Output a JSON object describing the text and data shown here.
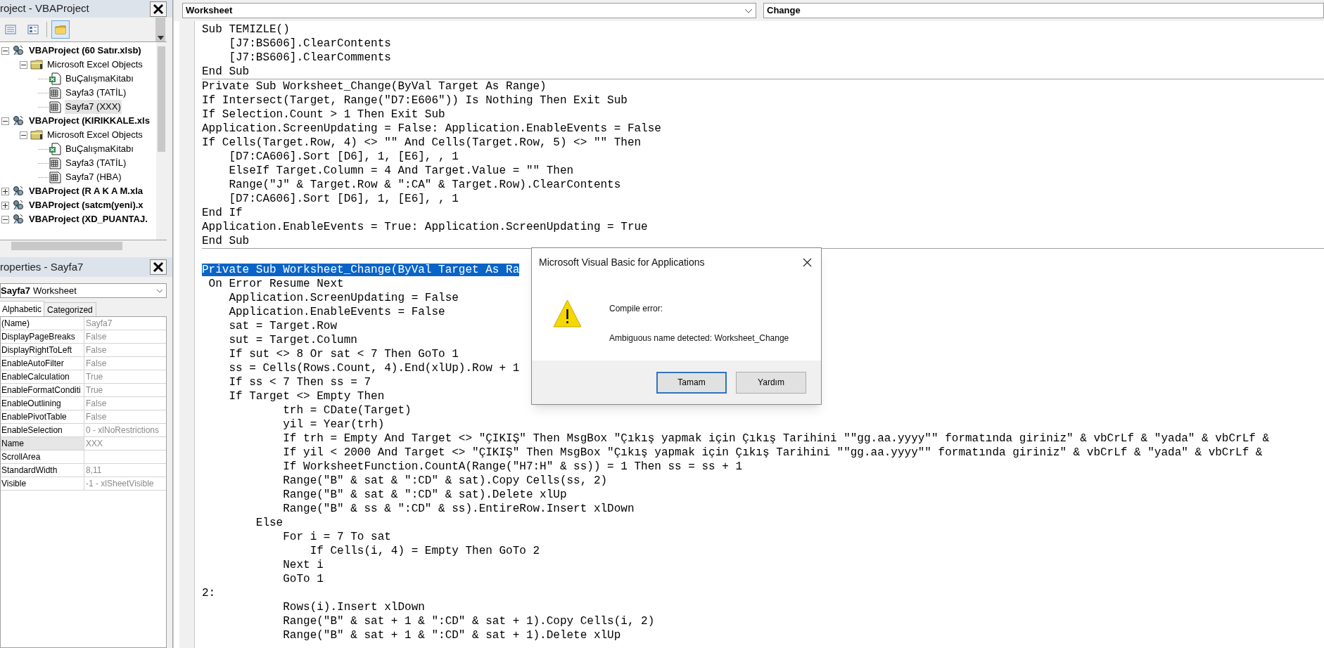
{
  "project_pane": {
    "title": "roject - VBAProject",
    "toolbar": [
      {
        "kind": "view-code",
        "pressed": false
      },
      {
        "kind": "view-object",
        "pressed": false
      },
      {
        "kind": "toggle-folders",
        "pressed": true
      }
    ],
    "tree": [
      {
        "kind": "project",
        "label": "VBAProject (60 Satır.xlsb)",
        "expanded": true,
        "selected": false,
        "children": [
          {
            "kind": "folder",
            "label": "Microsoft Excel Objects",
            "expanded": true,
            "selected": false,
            "children": [
              {
                "kind": "workbook",
                "label": "BuÇalışmaKitabı",
                "selected": false
              },
              {
                "kind": "sheet",
                "label": "Sayfa3 (TATİL)",
                "selected": false
              },
              {
                "kind": "sheet",
                "label": "Sayfa7 (XXX)",
                "selected": true
              }
            ]
          }
        ]
      },
      {
        "kind": "project",
        "label": "VBAProject (KIRIKKALE.xls",
        "expanded": true,
        "selected": false,
        "children": [
          {
            "kind": "folder",
            "label": "Microsoft Excel Objects",
            "expanded": true,
            "selected": false,
            "children": [
              {
                "kind": "workbook",
                "label": "BuÇalışmaKitabı",
                "selected": false
              },
              {
                "kind": "sheet",
                "label": "Sayfa3 (TATİL)",
                "selected": false
              },
              {
                "kind": "sheet",
                "label": "Sayfa7 (HBA)",
                "selected": false
              }
            ]
          }
        ]
      },
      {
        "kind": "project",
        "label": "VBAProject (R A K A M.xla",
        "expanded": false,
        "selected": false
      },
      {
        "kind": "project",
        "label": "VBAProject (satcm(yeni).x",
        "expanded": false,
        "selected": false
      },
      {
        "kind": "project",
        "label": "VBAProject (XD_PUANTAJ.",
        "expanded": true,
        "selected": false
      }
    ]
  },
  "properties_pane": {
    "title": "roperties - Sayfa7",
    "object_name": "Sayfa7",
    "object_type": "Worksheet",
    "tabs": [
      {
        "label": "Alphabetic",
        "selected": true
      },
      {
        "label": "Categorized",
        "selected": false
      }
    ],
    "rows": [
      {
        "name": "(Name)",
        "value": "Sayfa7",
        "selected": false
      },
      {
        "name": "DisplayPageBreaks",
        "value": "False",
        "selected": false
      },
      {
        "name": "DisplayRightToLeft",
        "value": "False",
        "selected": false
      },
      {
        "name": "EnableAutoFilter",
        "value": "False",
        "selected": false
      },
      {
        "name": "EnableCalculation",
        "value": "True",
        "selected": false
      },
      {
        "name": "EnableFormatConditi",
        "value": "True",
        "selected": false
      },
      {
        "name": "EnableOutlining",
        "value": "False",
        "selected": false
      },
      {
        "name": "EnablePivotTable",
        "value": "False",
        "selected": false
      },
      {
        "name": "EnableSelection",
        "value": "0 - xlNoRestrictions",
        "selected": false
      },
      {
        "name": "Name",
        "value": "XXX",
        "selected": true
      },
      {
        "name": "ScrollArea",
        "selected": false
      },
      {
        "name": "StandardWidth",
        "value": "8,11",
        "selected": false
      },
      {
        "name": "Visible",
        "value": "-1 - xlSheetVisible",
        "selected": false
      }
    ]
  },
  "code_window": {
    "object_dropdown": "Worksheet",
    "procedure_dropdown": "Change",
    "sections": [
      {
        "lines": [
          {
            "text": "Sub TEMIZLE()",
            "selected": false
          },
          {
            "text": "    [J7:BS606].ClearContents",
            "selected": false
          },
          {
            "text": "    [J7:BS606].ClearComments",
            "selected": false
          },
          {
            "text": "End Sub",
            "selected": false
          }
        ]
      },
      {
        "lines": [
          {
            "text": "Private Sub Worksheet_Change(ByVal Target As Range)",
            "selected": false
          },
          {
            "text": "If Intersect(Target, Range(\"D7:E606\")) Is Nothing Then Exit Sub",
            "selected": false
          },
          {
            "text": "If Selection.Count > 1 Then Exit Sub",
            "selected": false
          },
          {
            "text": "Application.ScreenUpdating = False: Application.EnableEvents = False",
            "selected": false
          },
          {
            "text": "If Cells(Target.Row, 4) <> \"\" And Cells(Target.Row, 5) <> \"\" Then",
            "selected": false
          },
          {
            "text": "    [D7:CA606].Sort [D6], 1, [E6], , 1",
            "selected": false
          },
          {
            "text": "    ElseIf Target.Column = 4 And Target.Value = \"\" Then",
            "selected": false
          },
          {
            "text": "    Range(\"J\" & Target.Row & \":CA\" & Target.Row).ClearContents",
            "selected": false
          },
          {
            "text": "    [D7:CA606].Sort [D6], 1, [E6], , 1",
            "selected": false
          },
          {
            "text": "End If",
            "selected": false
          },
          {
            "text": "Application.EnableEvents = True: Application.ScreenUpdating = True",
            "selected": false
          },
          {
            "text": "End Sub",
            "selected": false
          }
        ]
      },
      {
        "lines": [
          {
            "text": "Private Sub Worksheet_Change(ByVal Target As Ra",
            "selected": true
          },
          {
            "text": " On Error Resume Next",
            "selected": false
          },
          {
            "text": "    Application.ScreenUpdating = False",
            "selected": false
          },
          {
            "text": "    Application.EnableEvents = False",
            "selected": false
          },
          {
            "text": "    sat = Target.Row",
            "selected": false
          },
          {
            "text": "    sut = Target.Column",
            "selected": false
          },
          {
            "text": "    If sut <> 8 Or sat < 7 Then GoTo 1",
            "selected": false
          },
          {
            "text": "    ss = Cells(Rows.Count, 4).End(xlUp).Row + 1",
            "selected": false
          },
          {
            "text": "    If ss < 7 Then ss = 7",
            "selected": false
          },
          {
            "text": "    If Target <> Empty Then",
            "selected": false
          },
          {
            "text": "            trh = CDate(Target)",
            "selected": false
          },
          {
            "text": "            yil = Year(trh)",
            "selected": false
          },
          {
            "text": "            If trh = Empty And Target <> \"ÇIKIŞ\" Then MsgBox \"Çıkış yapmak için Çıkış Tarihini \"\"gg.aa.yyyy\"\" formatında giriniz\" & vbCrLf & \"yada\" & vbCrLf &",
            "selected": false
          },
          {
            "text": "            If yil < 2000 And Target <> \"ÇIKIŞ\" Then MsgBox \"Çıkış yapmak için Çıkış Tarihini \"\"gg.aa.yyyy\"\" formatında giriniz\" & vbCrLf & \"yada\" & vbCrLf &",
            "selected": false
          },
          {
            "text": "            If WorksheetFunction.CountA(Range(\"H7:H\" & ss)) = 1 Then ss = ss + 1",
            "selected": false
          },
          {
            "text": "            Range(\"B\" & sat & \":CD\" & sat).Copy Cells(ss, 2)",
            "selected": false
          },
          {
            "text": "            Range(\"B\" & sat & \":CD\" & sat).Delete xlUp",
            "selected": false
          },
          {
            "text": "            Range(\"B\" & ss & \":CD\" & ss).EntireRow.Insert xlDown",
            "selected": false
          },
          {
            "text": "        Else",
            "selected": false
          },
          {
            "text": "            For i = 7 To sat",
            "selected": false
          },
          {
            "text": "                If Cells(i, 4) = Empty Then GoTo 2",
            "selected": false
          },
          {
            "text": "            Next i",
            "selected": false
          },
          {
            "text": "            GoTo 1",
            "selected": false
          },
          {
            "text": "2:",
            "selected": false
          },
          {
            "text": "            Rows(i).Insert xlDown",
            "selected": false
          },
          {
            "text": "            Range(\"B\" & sat + 1 & \":CD\" & sat + 1).Copy Cells(i, 2)",
            "selected": false
          },
          {
            "text": "            Range(\"B\" & sat + 1 & \":CD\" & sat + 1).Delete xlUp",
            "selected": false
          }
        ]
      }
    ]
  },
  "dialog": {
    "title": "Microsoft Visual Basic for Applications",
    "heading": "Compile error:",
    "message": "Ambiguous name detected: Worksheet_Change",
    "buttons": [
      {
        "label": "Tamam",
        "selected": true
      },
      {
        "label": "Yardım",
        "selected": false
      }
    ]
  }
}
